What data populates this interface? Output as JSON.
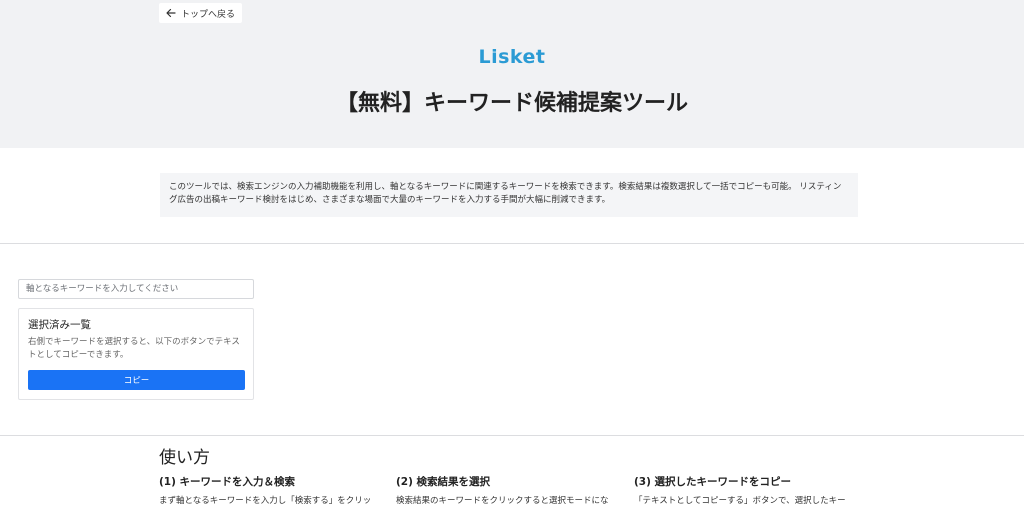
{
  "header": {
    "back_label": "トップへ戻る",
    "logo_text": "Lisket",
    "page_title": "【無料】キーワード候補提案ツール"
  },
  "intro": {
    "text": "このツールでは、検索エンジンの入力補助機能を利用し、軸となるキーワードに関連するキーワードを検索できます。検索結果は複数選択して一括でコピーも可能。 リスティング広告の出稿キーワード検討をはじめ、さまざまな場面で大量のキーワードを入力する手間が大幅に削減できます。"
  },
  "search": {
    "placeholder": "軸となるキーワードを入力してください",
    "value": ""
  },
  "selected": {
    "title": "選択済み一覧",
    "description": "右側でキーワードを選択すると、以下のボタンでテキストとしてコピーできます。",
    "copy_label": "コピー"
  },
  "howto": {
    "title": "使い方",
    "steps": [
      {
        "title": "(1) キーワードを入力＆検索",
        "desc": "まず軸となるキーワードを入力し「検索する」をクリッ"
      },
      {
        "title": "(2) 検索結果を選択",
        "desc": "検索結果のキーワードをクリックすると選択モードにな"
      },
      {
        "title": "(3) 選択したキーワードをコピー",
        "desc": "「テキストとしてコピーする」ボタンで、選択したキー"
      }
    ]
  },
  "colors": {
    "accent": "#1a73f5",
    "logo": "#2b9bd4",
    "hero_bg": "#f1f2f4"
  }
}
